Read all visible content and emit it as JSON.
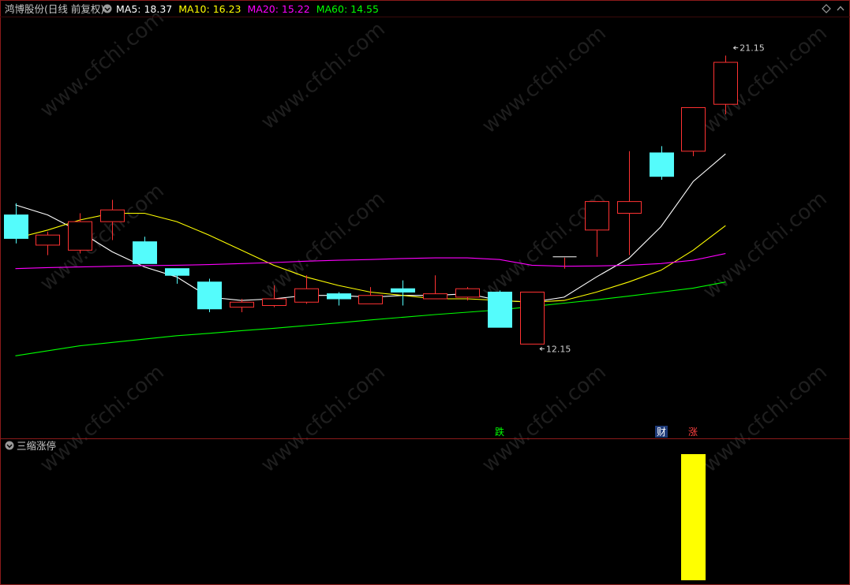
{
  "main_panel": {
    "title": "鸿博股份(日线 前复权)",
    "ma_labels": [
      {
        "text": "MA5: 18.37",
        "color": "#ffffff"
      },
      {
        "text": "MA10: 16.23",
        "color": "#ffff00"
      },
      {
        "text": "MA20: 15.22",
        "color": "#ff00ff"
      },
      {
        "text": "MA60: 14.55",
        "color": "#00ff00"
      }
    ],
    "expand_icon": "chevron-down-circle-icon",
    "corner_icon": "diamond-icon"
  },
  "sub_panel": {
    "title": "三缩涨停",
    "expand_icon": "chevron-down-circle-icon"
  },
  "colors": {
    "background": "#000000",
    "border": "#8b1a1a",
    "up": "#ff3232",
    "down": "#54fcfc",
    "ma5": "#ffffff",
    "ma10": "#ffff00",
    "ma20": "#ff00ff",
    "ma60": "#00ff00",
    "indicator": "#ffff00"
  },
  "chart_data": {
    "type": "candlestick",
    "ylim": [
      11.3,
      21.9
    ],
    "candles": [
      {
        "o": 16.55,
        "c": 15.85,
        "h": 16.9,
        "l": 15.7
      },
      {
        "o": 15.65,
        "c": 15.95,
        "h": 16.05,
        "l": 15.35
      },
      {
        "o": 15.5,
        "c": 16.35,
        "h": 16.6,
        "l": 15.4
      },
      {
        "o": 16.35,
        "c": 16.7,
        "h": 17.0,
        "l": 15.8
      },
      {
        "o": 15.75,
        "c": 15.1,
        "h": 15.9,
        "l": 15.1
      },
      {
        "o": 14.95,
        "c": 14.75,
        "h": 14.95,
        "l": 14.5
      },
      {
        "o": 14.55,
        "c": 13.75,
        "h": 14.65,
        "l": 13.65
      },
      {
        "o": 13.8,
        "c": 13.95,
        "h": 14.05,
        "l": 13.65
      },
      {
        "o": 13.85,
        "c": 14.05,
        "h": 14.45,
        "l": 13.8
      },
      {
        "o": 13.95,
        "c": 14.35,
        "h": 14.75,
        "l": 13.9
      },
      {
        "o": 14.2,
        "c": 14.05,
        "h": 14.25,
        "l": 13.85
      },
      {
        "o": 13.9,
        "c": 14.15,
        "h": 14.4,
        "l": 13.9
      },
      {
        "o": 14.35,
        "c": 14.25,
        "h": 14.6,
        "l": 13.85
      },
      {
        "o": 14.05,
        "c": 14.2,
        "h": 14.75,
        "l": 14.05
      },
      {
        "o": 14.1,
        "c": 14.35,
        "h": 14.4,
        "l": 14.0
      },
      {
        "o": 14.25,
        "c": 13.2,
        "h": 14.3,
        "l": 13.2
      },
      {
        "o": 12.7,
        "c": 14.25,
        "h": 14.25,
        "l": 12.7
      },
      {
        "o": 15.3,
        "c": 15.3,
        "h": 15.3,
        "l": 14.95
      },
      {
        "o": 16.1,
        "c": 16.95,
        "h": 16.95,
        "l": 15.3
      },
      {
        "o": 16.6,
        "c": 16.95,
        "h": 18.45,
        "l": 15.35
      },
      {
        "o": 18.4,
        "c": 17.7,
        "h": 18.6,
        "l": 17.6
      },
      {
        "o": 18.45,
        "c": 19.75,
        "h": 19.75,
        "l": 18.3
      },
      {
        "o": 19.85,
        "c": 21.1,
        "h": 21.3,
        "l": 19.55
      }
    ],
    "ma": {
      "MA5": [
        16.85,
        16.55,
        16.05,
        15.45,
        15.0,
        14.7,
        14.1,
        14.0,
        14.05,
        14.15,
        14.15,
        14.1,
        14.15,
        14.15,
        14.2,
        14.0,
        13.95,
        14.1,
        14.7,
        15.25,
        16.2,
        17.55,
        18.37
      ],
      "MA10": [
        15.85,
        16.1,
        16.4,
        16.6,
        16.6,
        16.35,
        15.95,
        15.5,
        15.05,
        14.7,
        14.45,
        14.25,
        14.15,
        14.05,
        14.05,
        14.0,
        13.95,
        14.0,
        14.25,
        14.55,
        14.9,
        15.5,
        16.23
      ],
      "MA20": [
        14.95,
        14.98,
        15.0,
        15.02,
        15.04,
        15.05,
        15.07,
        15.1,
        15.13,
        15.17,
        15.2,
        15.22,
        15.25,
        15.27,
        15.27,
        15.22,
        15.05,
        15.02,
        15.03,
        15.05,
        15.1,
        15.2,
        15.4
      ],
      "MA60": [
        12.35,
        12.5,
        12.65,
        12.75,
        12.85,
        12.95,
        13.02,
        13.1,
        13.17,
        13.25,
        13.33,
        13.42,
        13.5,
        13.58,
        13.65,
        13.72,
        13.82,
        13.92,
        14.02,
        14.13,
        14.25,
        14.37,
        14.55
      ]
    },
    "annotations": [
      {
        "text": "21.15",
        "index": 22,
        "value": 21.25,
        "kind": "high"
      },
      {
        "text": "12.15",
        "index": 16,
        "value": 12.7,
        "kind": "low"
      }
    ],
    "markers": [
      {
        "text": "跌",
        "index": 15,
        "color": "#00ff00"
      },
      {
        "text": "财",
        "index": 20,
        "color": "#ffffff",
        "bg": "#1e3a78"
      },
      {
        "text": "涨",
        "index": 21,
        "color": "#ff4040"
      }
    ],
    "indicator": {
      "name": "三缩涨停",
      "values": [
        0,
        0,
        0,
        0,
        0,
        0,
        0,
        0,
        0,
        0,
        0,
        0,
        0,
        0,
        0,
        0,
        0,
        0,
        0,
        0,
        0,
        1,
        0
      ]
    }
  }
}
